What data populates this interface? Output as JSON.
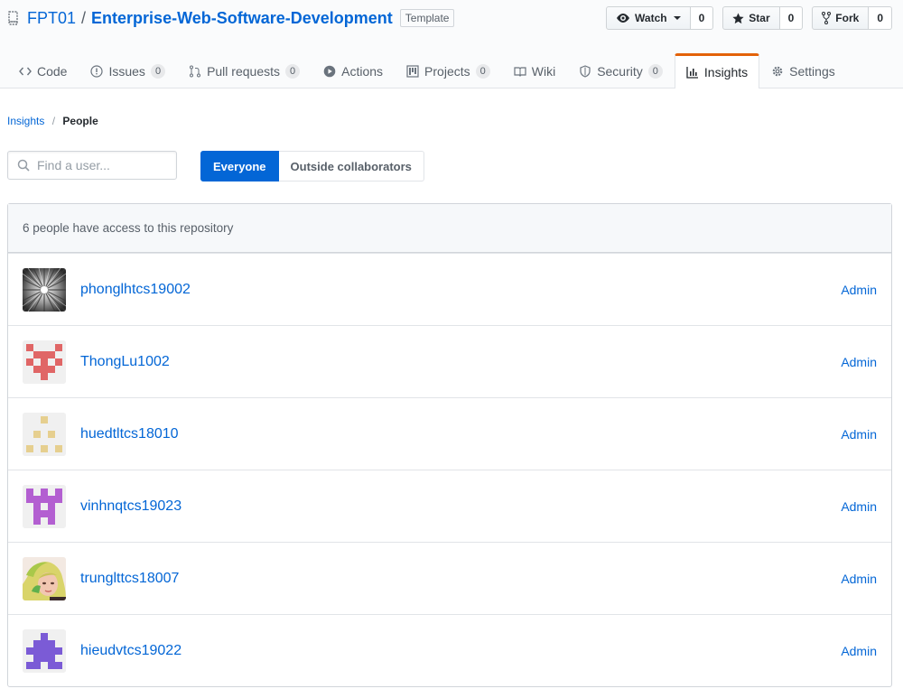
{
  "repo": {
    "owner": "FPT01",
    "separator": "/",
    "name": "Enterprise-Web-Software-Development",
    "template_label": "Template"
  },
  "actions": {
    "watch": {
      "label": "Watch",
      "count": "0"
    },
    "star": {
      "label": "Star",
      "count": "0"
    },
    "fork": {
      "label": "Fork",
      "count": "0"
    }
  },
  "tabs": [
    {
      "label": "Code",
      "icon": "code-icon"
    },
    {
      "label": "Issues",
      "icon": "issue-icon",
      "count": "0"
    },
    {
      "label": "Pull requests",
      "icon": "pull-request-icon",
      "count": "0"
    },
    {
      "label": "Actions",
      "icon": "play-icon"
    },
    {
      "label": "Projects",
      "icon": "project-icon",
      "count": "0"
    },
    {
      "label": "Wiki",
      "icon": "book-icon"
    },
    {
      "label": "Security",
      "icon": "shield-icon",
      "count": "0"
    },
    {
      "label": "Insights",
      "icon": "graph-icon",
      "selected": true
    },
    {
      "label": "Settings",
      "icon": "gear-icon"
    }
  ],
  "breadcrumb": {
    "parent": "Insights",
    "current": "People"
  },
  "filter": {
    "search_placeholder": "Find a user...",
    "everyone": "Everyone",
    "outside": "Outside collaborators"
  },
  "people": {
    "header": "6 people have access to this repository",
    "list": [
      {
        "username": "phonglhtcs19002",
        "role": "Admin",
        "avatar": "photo-rays"
      },
      {
        "username": "ThongLu1002",
        "role": "Admin",
        "avatar": "identicon",
        "color": "#e06666"
      },
      {
        "username": "huedtltcs18010",
        "role": "Admin",
        "avatar": "identicon",
        "color": "#e6cf8f"
      },
      {
        "username": "vinhnqtcs19023",
        "role": "Admin",
        "avatar": "identicon",
        "color": "#b35fd1"
      },
      {
        "username": "trunglttcs18007",
        "role": "Admin",
        "avatar": "photo-person"
      },
      {
        "username": "hieudvtcs19022",
        "role": "Admin",
        "avatar": "identicon",
        "color": "#7b5bd6"
      }
    ]
  },
  "colors": {
    "link": "#0366d6",
    "selected_tab_accent": "#e36209",
    "primary_button": "#0366d6"
  }
}
